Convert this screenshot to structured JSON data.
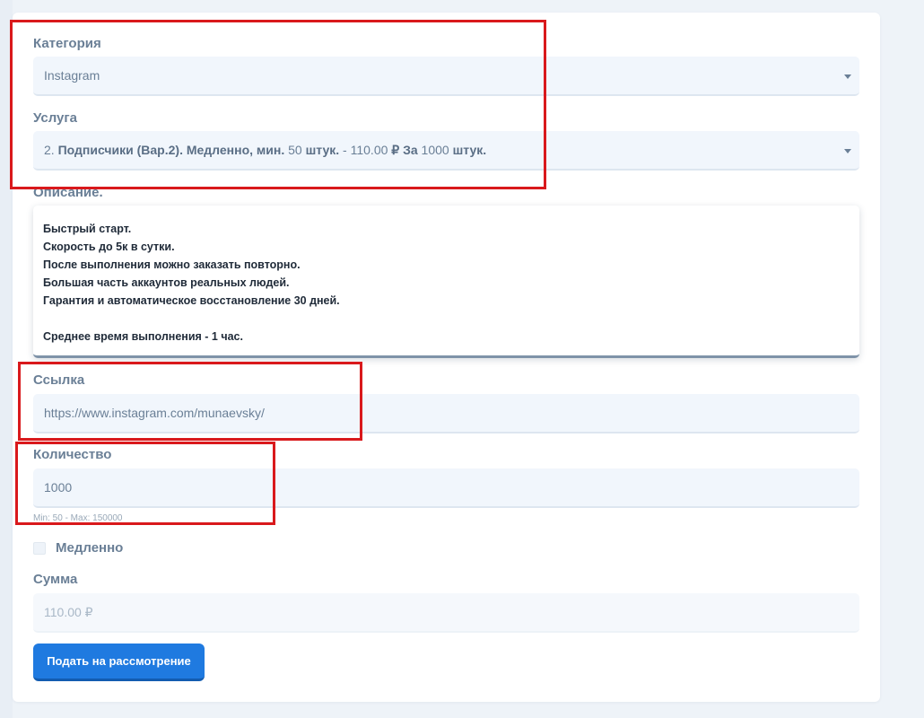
{
  "form": {
    "category": {
      "label": "Категория",
      "value": "Instagram"
    },
    "service": {
      "label": "Услуга",
      "num": "2.",
      "name": "Подписчики (Вар.2). Медленно, мин.",
      "min_val": "50",
      "min_unit": "штук.",
      "dash": "-",
      "price": "110.00",
      "per": "₽ За",
      "per_qty": "1000",
      "per_unit": "штук."
    },
    "description": {
      "label": "Описание.",
      "lines": [
        "Быстрый старт.",
        "Скорость до 5к в сутки.",
        "После выполнения можно заказать повторно.",
        "Большая часть аккаунтов реальных людей.",
        "Гарантия и автоматическое восстановление 30 дней.",
        "",
        "Среднее время выполнения - 1 час."
      ]
    },
    "link": {
      "label": "Ссылка",
      "value": "https://www.instagram.com/munaevsky/"
    },
    "quantity": {
      "label": "Количество",
      "value": "1000",
      "hint": "Min: 50 - Max: 150000"
    },
    "slow": {
      "label": "Медленно",
      "checked": false
    },
    "sum": {
      "label": "Сумма",
      "value": "110.00 ₽"
    },
    "submit_label": "Подать на рассмотрение"
  },
  "colors": {
    "accent": "#1f7ae0",
    "highlight_box": "#d9191c",
    "field_bg": "#f1f6fc",
    "label": "#6a7f96"
  },
  "icons": {
    "select_arrow": "caret-down-icon"
  }
}
